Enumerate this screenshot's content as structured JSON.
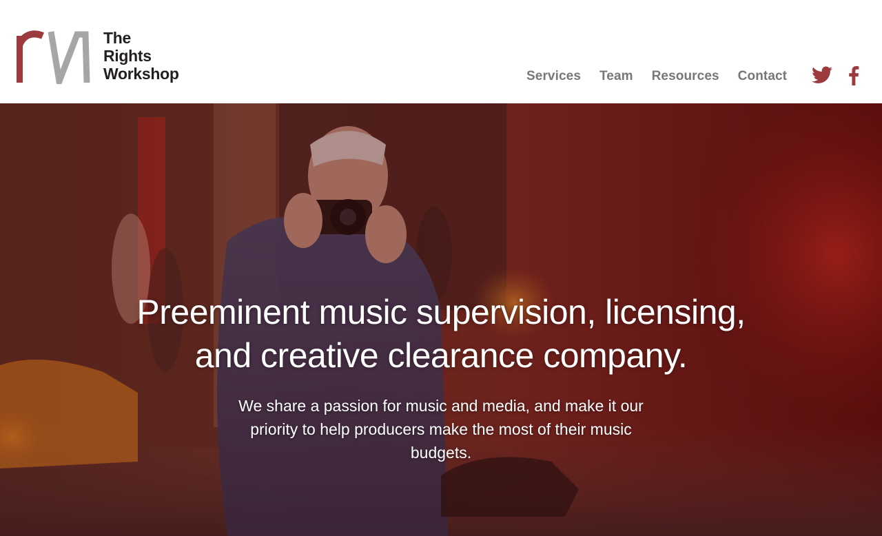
{
  "brand": {
    "line1": "The",
    "line2": "Rights",
    "line3": "Workshop",
    "mark_colors": {
      "r": "#9b3b3d",
      "n": "#a7a5a6"
    }
  },
  "nav": {
    "items": [
      {
        "label": "Services"
      },
      {
        "label": "Team"
      },
      {
        "label": "Resources"
      },
      {
        "label": "Contact"
      }
    ]
  },
  "social": {
    "icons": [
      "twitter-icon",
      "facebook-icon"
    ],
    "color": "#9b3b3d"
  },
  "hero": {
    "title_line1": "Preeminent music supervision, licensing,",
    "title_line2": "and creative clearance company.",
    "subtitle": "We share a passion for music and media, and make it our priority to help producers make the most of their music budgets.",
    "image": "photographer-taking-picture-street"
  },
  "colors": {
    "nav_text": "#777777",
    "brand_text": "#231f20",
    "hero_overlay": "#8a1e1e"
  }
}
